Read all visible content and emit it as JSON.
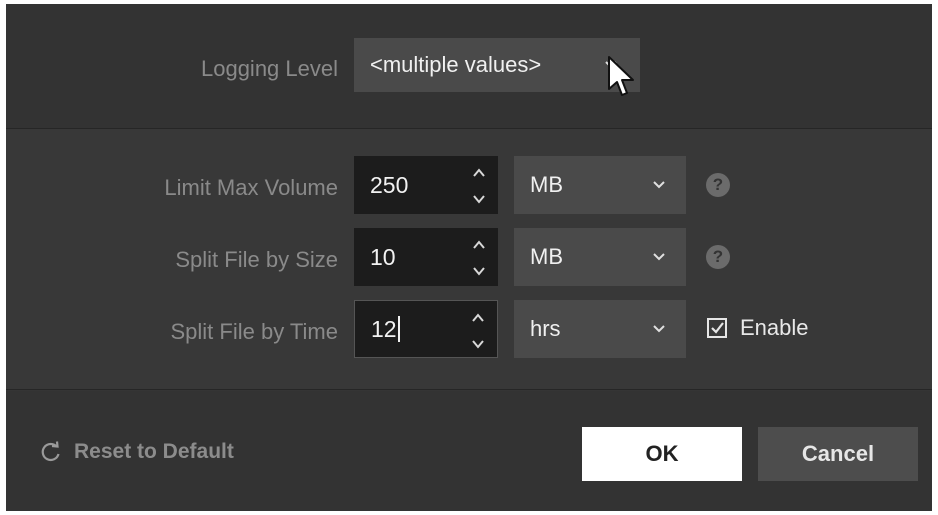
{
  "logging": {
    "label": "Logging Level",
    "value": "<multiple values>"
  },
  "rows": [
    {
      "label": "Limit Max Volume",
      "value": "250",
      "unit": "MB",
      "extra": "help"
    },
    {
      "label": "Split File by Size",
      "value": "10",
      "unit": "MB",
      "extra": "help"
    },
    {
      "label": "Split File by Time",
      "value": "12",
      "unit": "hrs",
      "extra": "checkbox"
    }
  ],
  "help_glyph": "?",
  "enable": {
    "label": "Enable",
    "checked": true
  },
  "footer": {
    "reset_label": "Reset to Default",
    "ok_label": "OK",
    "cancel_label": "Cancel"
  },
  "icons": {
    "dropdown": "chevron-down-icon",
    "spinner": "spinner-arrows-icon",
    "help": "help-icon",
    "reset": "reset-icon",
    "checkbox": "checkbox-checked-icon",
    "cursor": "mouse-cursor-icon"
  },
  "colors": {
    "background": "#353535",
    "field": "#1c1c1c",
    "select": "#4a4a4a",
    "primary_button": "#ffffff"
  }
}
